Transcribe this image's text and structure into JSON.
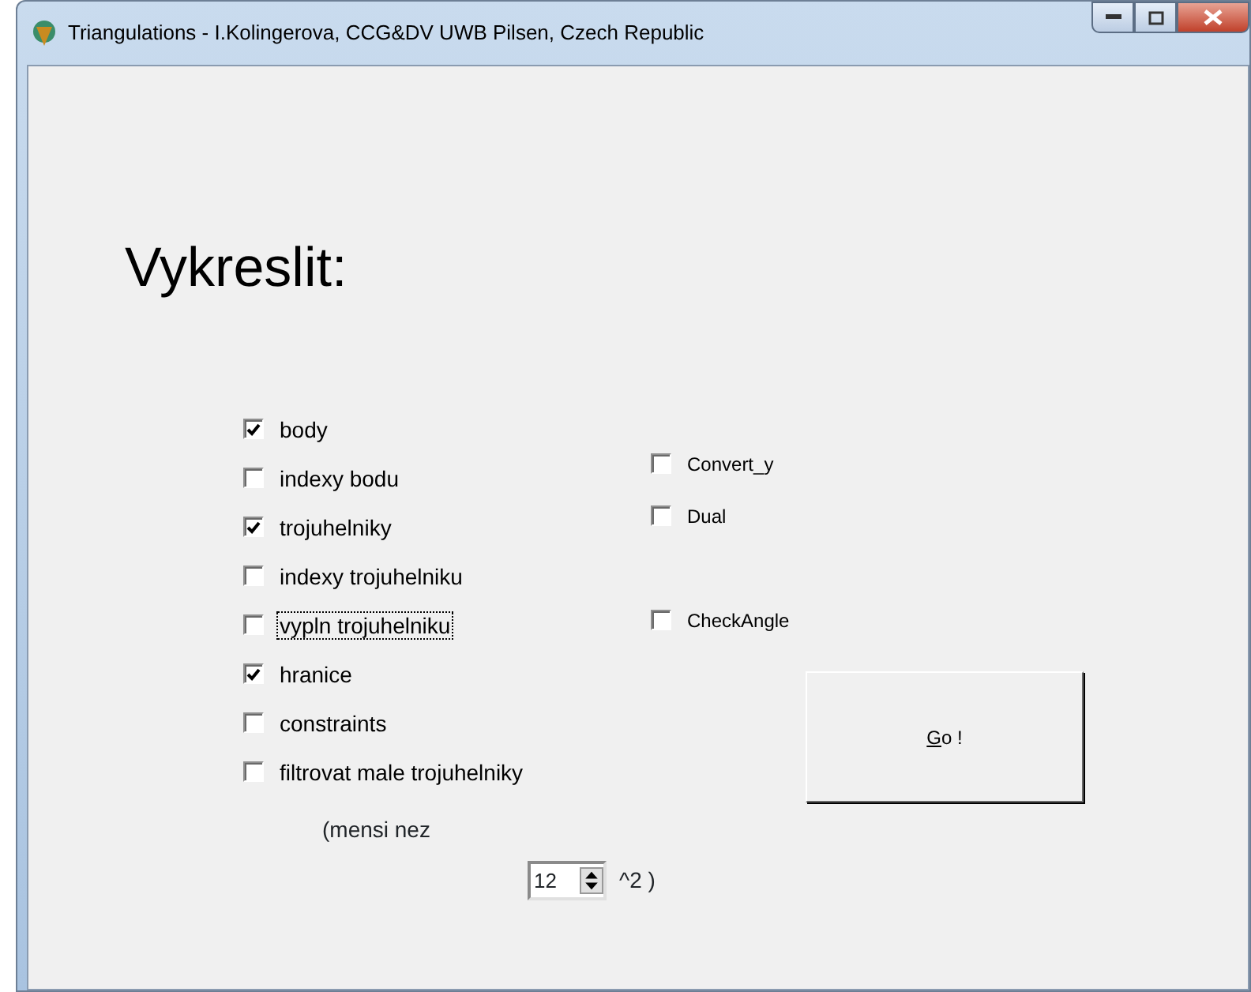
{
  "window": {
    "title": "Triangulations - I.Kolingerova, CCG&DV UWB Pilsen, Czech Republic"
  },
  "heading": "Vykreslit:",
  "left_options": [
    {
      "label": "body",
      "checked": true,
      "focused": false
    },
    {
      "label": "indexy bodu",
      "checked": false,
      "focused": false
    },
    {
      "label": "trojuhelniky",
      "checked": true,
      "focused": false
    },
    {
      "label": "indexy trojuhelniku",
      "checked": false,
      "focused": false
    },
    {
      "label": "vypln trojuhelniku",
      "checked": false,
      "focused": true
    },
    {
      "label": "hranice",
      "checked": true,
      "focused": false
    },
    {
      "label": "constraints",
      "checked": false,
      "focused": false
    },
    {
      "label": "filtrovat male trojuhelniky",
      "checked": false,
      "focused": false
    }
  ],
  "right_groups": [
    [
      {
        "label": "Convert_y",
        "checked": false
      },
      {
        "label": "Dual",
        "checked": false
      }
    ],
    [
      {
        "label": "CheckAngle",
        "checked": false
      }
    ]
  ],
  "go_button": {
    "mnemonic": "G",
    "label_rest": "o !"
  },
  "filter_prefix": "(mensi nez",
  "filter_value": "12",
  "filter_suffix": "^2 )"
}
